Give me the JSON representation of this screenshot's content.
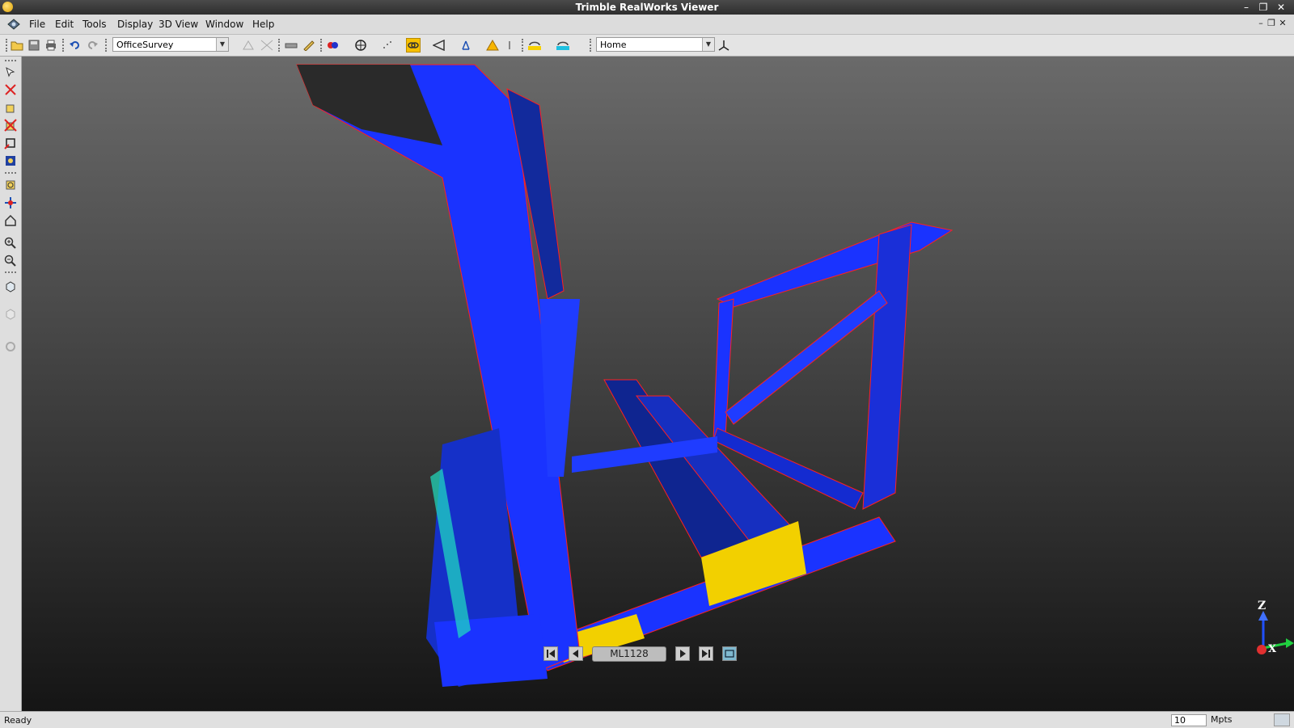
{
  "window": {
    "title": "Trimble RealWorks Viewer"
  },
  "menu": {
    "items": [
      "File",
      "Edit",
      "Tools",
      "Display",
      "3D View",
      "Window",
      "Help"
    ]
  },
  "toolbar": {
    "project_combo": "OfficeSurvey",
    "view_combo": "Home"
  },
  "viewer": {
    "station_name": "ML1128"
  },
  "axes": {
    "z": "Z",
    "y": "Y",
    "x": "X"
  },
  "status": {
    "text": "Ready",
    "points_value": "10",
    "points_unit": "Mpts"
  },
  "colors": {
    "accent": "#1a33ff",
    "frame_outline": "#ff2020",
    "highlight": "#ffd800"
  }
}
